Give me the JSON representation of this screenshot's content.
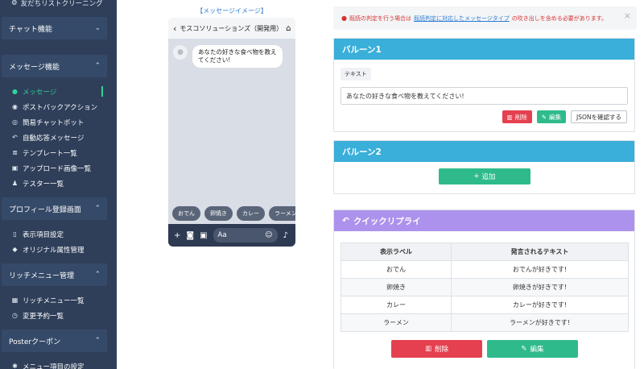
{
  "sidebar": {
    "top_item": "友だちリストクリーニング",
    "sections": [
      {
        "label": "チャット機能",
        "items": []
      },
      {
        "label": "メッセージ機能",
        "items": [
          {
            "label": "メッセージ",
            "icon": "chat-bubble-icon",
            "active": true
          },
          {
            "label": "ポストバックアクション",
            "icon": "robot-icon"
          },
          {
            "label": "簡易チャットボット",
            "icon": "headset-icon"
          },
          {
            "label": "自動応答メッセージ",
            "icon": "reply-icon"
          },
          {
            "label": "テンプレート一覧",
            "icon": "layers-icon"
          },
          {
            "label": "アップロード画像一覧",
            "icon": "image-icon"
          },
          {
            "label": "テスター一覧",
            "icon": "users-icon"
          }
        ]
      },
      {
        "label": "プロフィール登録画面",
        "items": [
          {
            "label": "表示項目設定",
            "icon": "mobile-icon"
          },
          {
            "label": "オリジナル属性管理",
            "icon": "tag-icon"
          }
        ]
      },
      {
        "label": "リッチメニュー管理",
        "items": [
          {
            "label": "リッチメニュー一覧",
            "icon": "grid-icon"
          },
          {
            "label": "変更予約一覧",
            "icon": "clock-icon"
          }
        ]
      },
      {
        "label": "Posterクーポン",
        "items": [
          {
            "label": "メニュー項目の設定",
            "icon": "gear-icon"
          }
        ]
      }
    ]
  },
  "preview": {
    "title": "【メッセージイメージ】",
    "account_name": "モスコソリューションズ（開発用）",
    "message": "あなたの好きな食べ物を教えてください!",
    "quick_replies": [
      "おでん",
      "卵焼き",
      "カレー",
      "ラーメン"
    ],
    "input_placeholder": "Aa"
  },
  "alert": {
    "prefix": "既読の判定を行う場合は",
    "link": "既読判定に対応したメッセージタイプ",
    "suffix": "の吹き出しを含める必要があります。"
  },
  "balloon1": {
    "title": "バルーン1",
    "type_tag": "テキスト",
    "text": "あなたの好きな食べ物を教えてください!",
    "delete_label": "削除",
    "edit_label": "編集",
    "json_label": "JSONを確認する"
  },
  "balloon2": {
    "title": "バルーン2",
    "add_label": "追加"
  },
  "quick_reply": {
    "title": "クイックリプライ",
    "columns": [
      "表示ラベル",
      "発言されるテキスト"
    ],
    "rows": [
      [
        "おでん",
        "おでんが好きです!"
      ],
      [
        "卵焼き",
        "卵焼きが好きです!"
      ],
      [
        "カレー",
        "カレーが好きです!"
      ],
      [
        "ラーメン",
        "ラーメンが好きです!"
      ]
    ],
    "delete_label": "削除",
    "edit_label": "編集"
  },
  "colors": {
    "sidebar_bg": "#2f3f5a",
    "accent_green": "#30d39a",
    "balloon_header": "#3aafda",
    "quick_reply_header": "#ac92ec",
    "danger": "#e5404f",
    "success": "#2fba8c"
  }
}
